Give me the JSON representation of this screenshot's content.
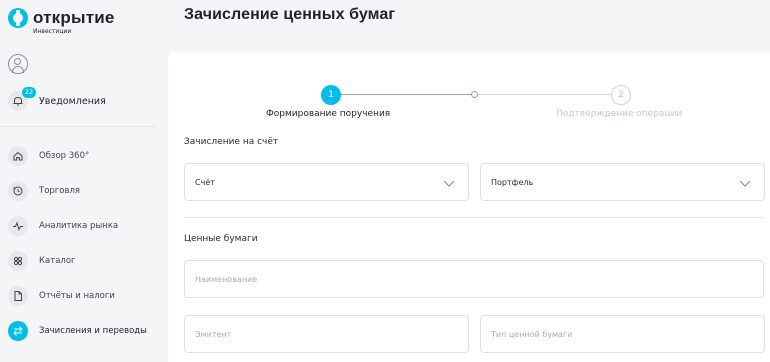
{
  "brand": {
    "name": "открытие",
    "subtitle": "Инвестиции"
  },
  "sidebar": {
    "notifications": {
      "label": "Уведомления",
      "count": "22"
    },
    "items": [
      {
        "label": "Обзор 360°",
        "icon": "home-icon",
        "active": false
      },
      {
        "label": "Торговля",
        "icon": "trade-icon",
        "active": false
      },
      {
        "label": "Аналитика рынка",
        "icon": "pulse-icon",
        "active": false
      },
      {
        "label": "Каталог",
        "icon": "grid-icon",
        "active": false
      },
      {
        "label": "Отчёты и налоги",
        "icon": "document-icon",
        "active": false
      },
      {
        "label": "Зачисления и переводы",
        "icon": "transfer-icon",
        "active": true
      }
    ]
  },
  "main": {
    "title": "Зачисление ценных бумаг",
    "steps": [
      {
        "number": "1",
        "label": "Формирование поручения",
        "active": true
      },
      {
        "number": "2",
        "label": "Подтверждение операции",
        "active": false
      }
    ],
    "account_section": {
      "title": "Зачисление на счёт",
      "account": "Счёт",
      "portfolio": "Портфель"
    },
    "securities_section": {
      "title": "Ценные бумаги",
      "name_placeholder": "Наименование",
      "issuer_placeholder": "Эмитент",
      "type_placeholder": "Тип ценной бумаги"
    }
  },
  "colors": {
    "accent": "#00bee8",
    "text": "#1f2229",
    "muted": "#a7abb3"
  }
}
